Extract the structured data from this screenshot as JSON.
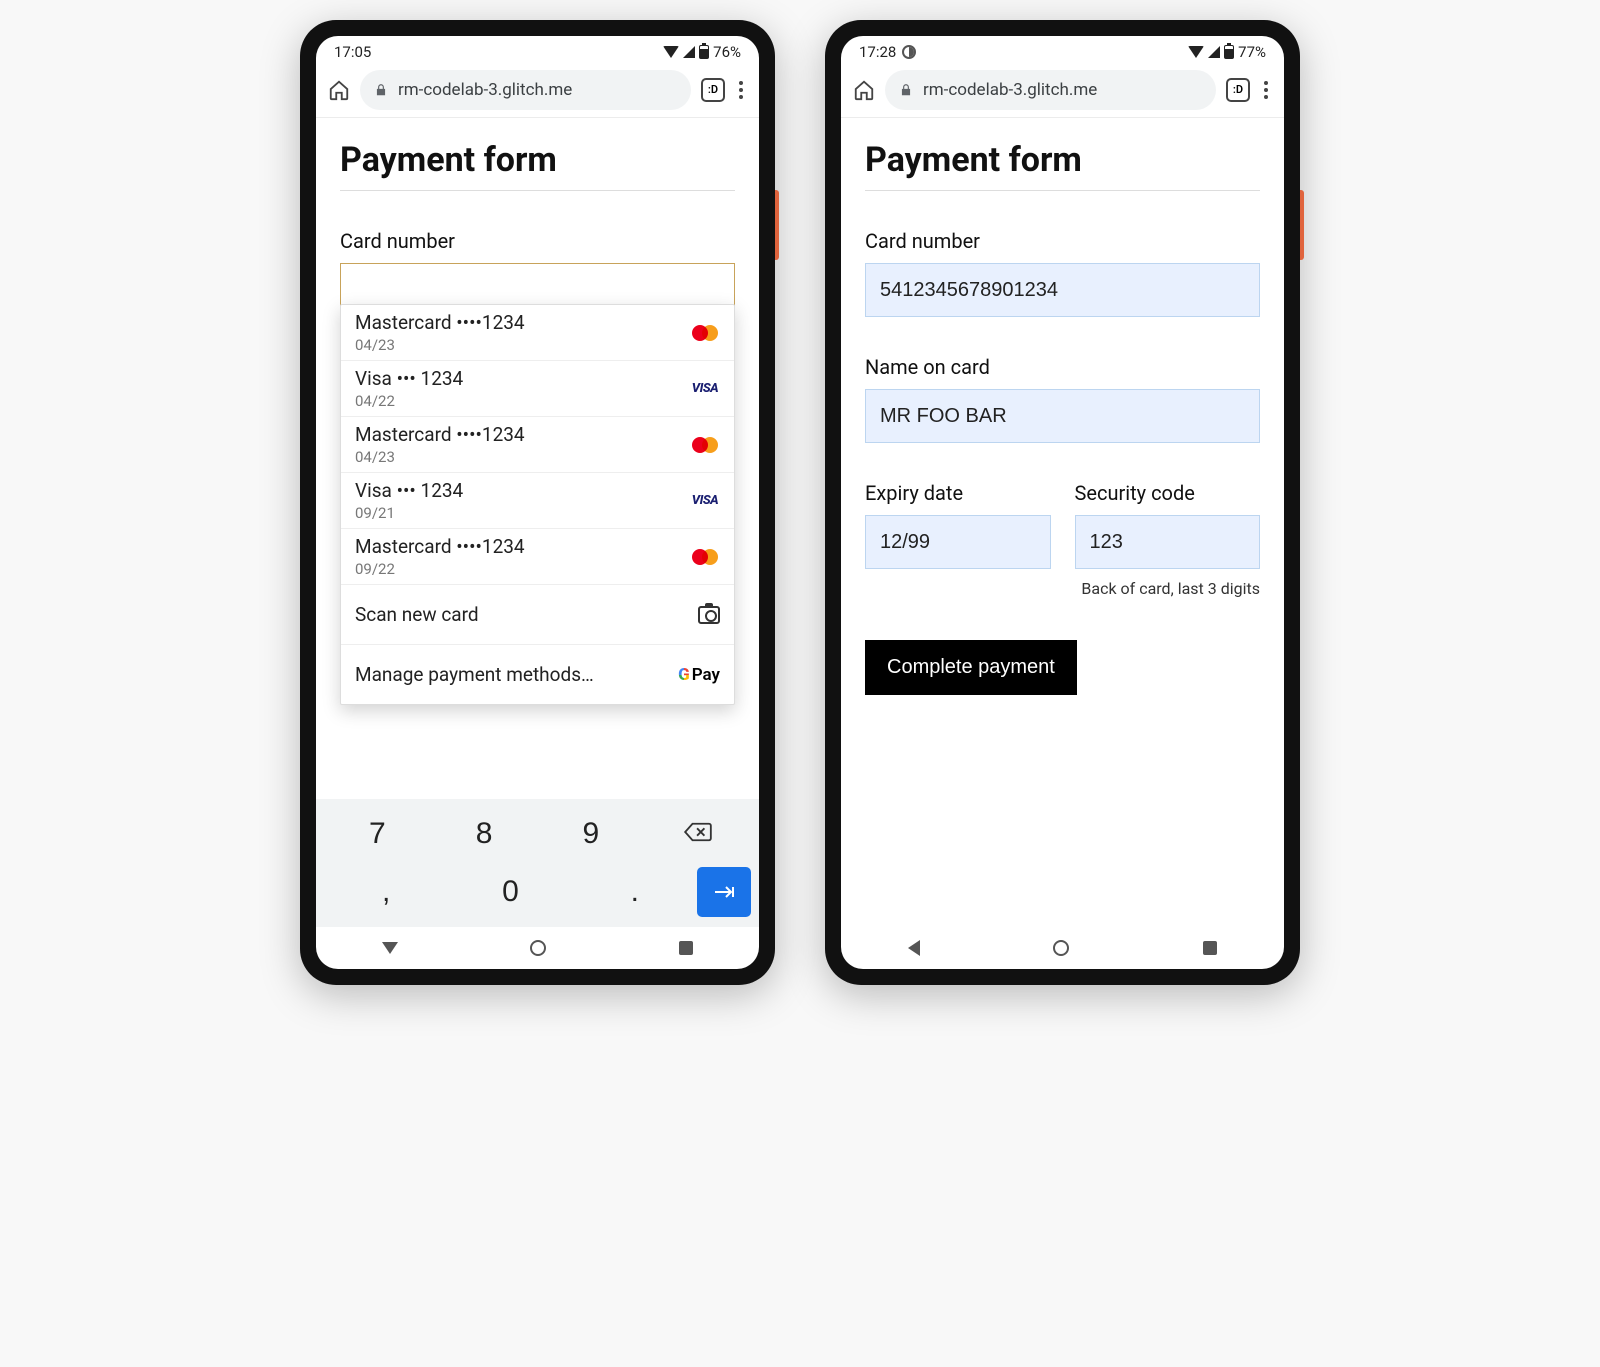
{
  "phone1": {
    "status": {
      "time": "17:05",
      "battery": "76%"
    },
    "url": "rm-codelab-3.glitch.me",
    "tab_count": ":D",
    "title": "Payment form",
    "card_number_label": "Card number",
    "autofill": {
      "cards": [
        {
          "brand": "Mastercard",
          "masked": "••••1234",
          "exp": "04/23",
          "logo": "mc"
        },
        {
          "brand": "Visa",
          "masked": "••• 1234",
          "exp": "04/22",
          "logo": "visa"
        },
        {
          "brand": "Mastercard",
          "masked": "••••1234",
          "exp": "04/23",
          "logo": "mc"
        },
        {
          "brand": "Visa",
          "masked": "••• 1234",
          "exp": "09/21",
          "logo": "visa"
        },
        {
          "brand": "Mastercard",
          "masked": "••••1234",
          "exp": "09/22",
          "logo": "mc"
        }
      ],
      "scan": "Scan new card",
      "manage": "Manage payment methods…",
      "gpay": "Pay"
    },
    "keyboard": {
      "row1": [
        "7",
        "8",
        "9"
      ],
      "row2": [
        ",",
        "0",
        "."
      ]
    }
  },
  "phone2": {
    "status": {
      "time": "17:28",
      "battery": "77%"
    },
    "url": "rm-codelab-3.glitch.me",
    "tab_count": ":D",
    "title": "Payment form",
    "fields": {
      "card_number_label": "Card number",
      "card_number_value": "5412345678901234",
      "name_label": "Name on card",
      "name_value": "MR FOO BAR",
      "expiry_label": "Expiry date",
      "expiry_value": "12/99",
      "cvc_label": "Security code",
      "cvc_value": "123",
      "cvc_hint": "Back of card, last 3 digits"
    },
    "submit": "Complete payment"
  }
}
